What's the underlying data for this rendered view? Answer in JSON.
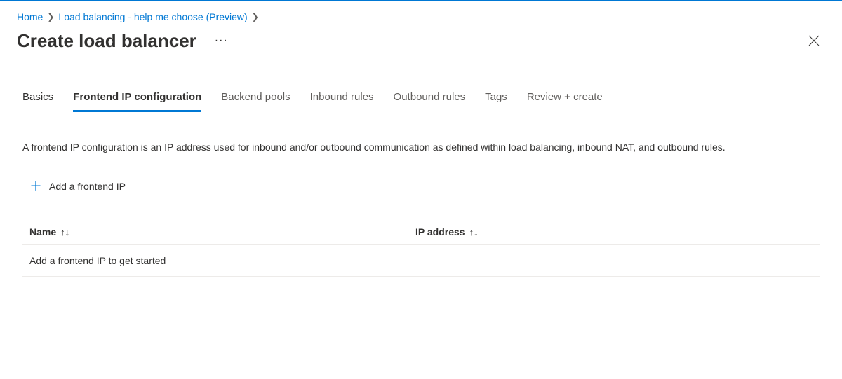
{
  "breadcrumb": {
    "items": [
      {
        "label": "Home"
      },
      {
        "label": "Load balancing - help me choose (Preview)"
      }
    ]
  },
  "header": {
    "title": "Create load balancer"
  },
  "tabs": [
    {
      "label": "Basics",
      "state": "completed"
    },
    {
      "label": "Frontend IP configuration",
      "state": "active"
    },
    {
      "label": "Backend pools",
      "state": "default"
    },
    {
      "label": "Inbound rules",
      "state": "default"
    },
    {
      "label": "Outbound rules",
      "state": "default"
    },
    {
      "label": "Tags",
      "state": "default"
    },
    {
      "label": "Review + create",
      "state": "default"
    }
  ],
  "main": {
    "description": "A frontend IP configuration is an IP address used for inbound and/or outbound communication as defined within load balancing, inbound NAT, and outbound rules.",
    "add_button_label": "Add a frontend IP",
    "table": {
      "columns": {
        "name": "Name",
        "ip": "IP address"
      },
      "empty_message": "Add a frontend IP to get started"
    }
  }
}
